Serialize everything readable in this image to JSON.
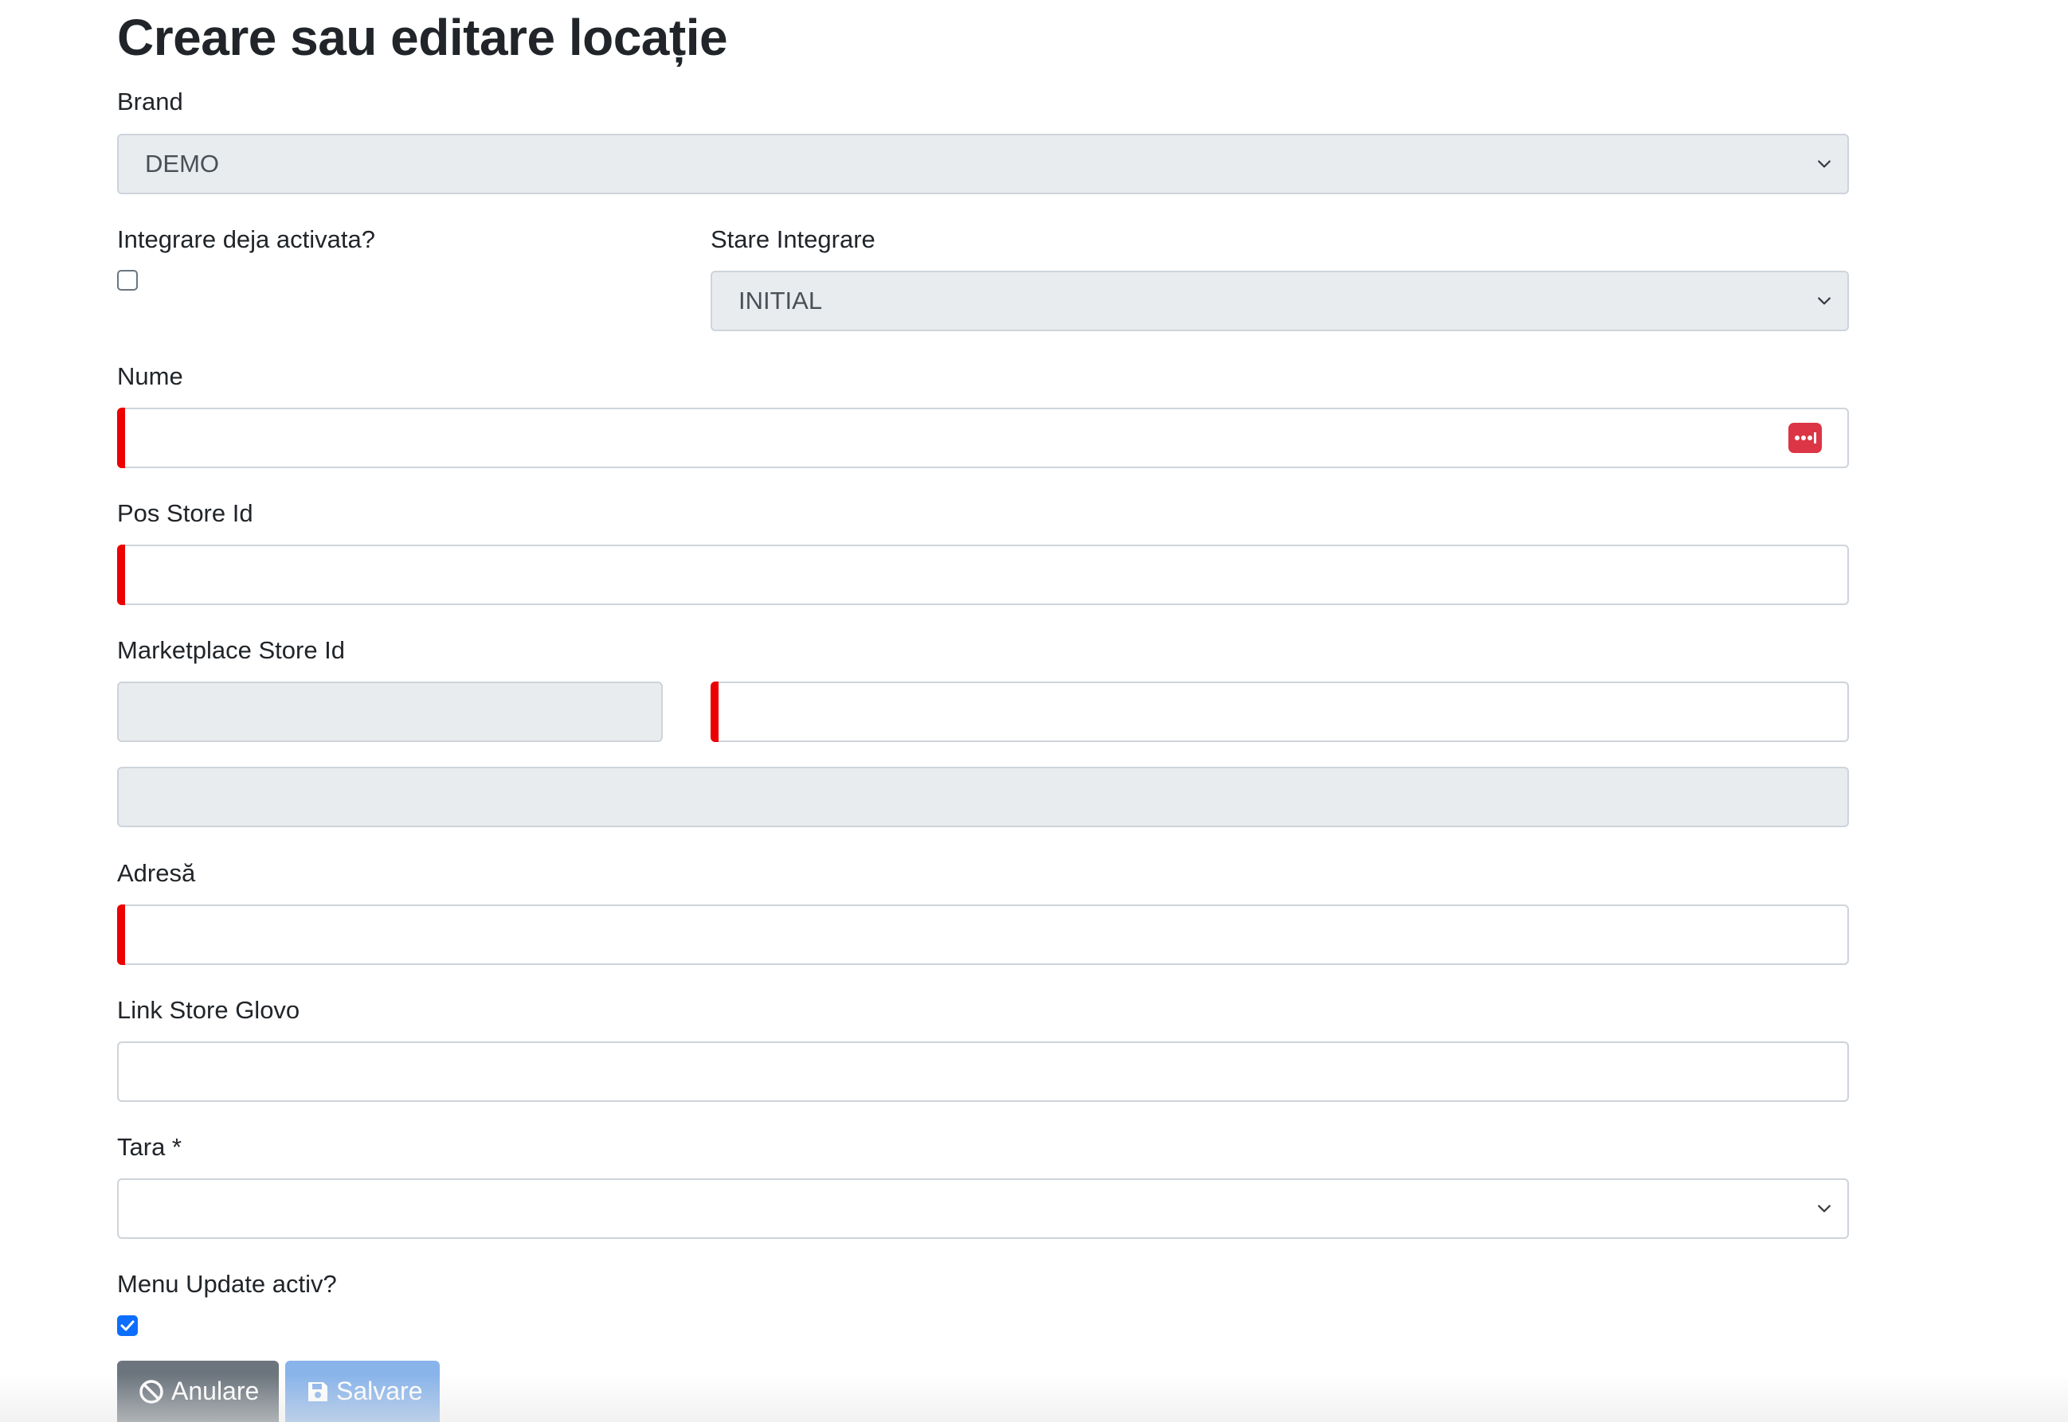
{
  "page": {
    "title": "Creare sau editare locație"
  },
  "form": {
    "brand": {
      "label": "Brand",
      "value": "DEMO"
    },
    "integration_activated": {
      "label": "Integrare deja activata?",
      "checked": false
    },
    "integration_state": {
      "label": "Stare Integrare",
      "value": "INITIAL"
    },
    "name": {
      "label": "Nume",
      "value": ""
    },
    "pos_store_id": {
      "label": "Pos Store Id",
      "value": ""
    },
    "marketplace_store_id": {
      "label": "Marketplace Store Id",
      "prefix_value": "",
      "value": "",
      "extra_value": ""
    },
    "address": {
      "label": "Adresă",
      "value": ""
    },
    "glovo_link": {
      "label": "Link Store Glovo",
      "value": ""
    },
    "country": {
      "label": "Tara *",
      "value": ""
    },
    "menu_update": {
      "label": "Menu Update activ?",
      "checked": true
    }
  },
  "actions": {
    "cancel_label": "Anulare",
    "save_label": "Salvare"
  },
  "icons": {
    "cancel": "ban-icon",
    "save": "floppy-disk-icon",
    "password_manager": "password-manager-icon",
    "select_arrow": "chevron-down-icon"
  },
  "colors": {
    "required_marker": "#ee0000",
    "primary": "#0d6efd",
    "save_button": "#89b4ea",
    "cancel_button": "#6c757d",
    "password_icon": "#dc3545"
  }
}
